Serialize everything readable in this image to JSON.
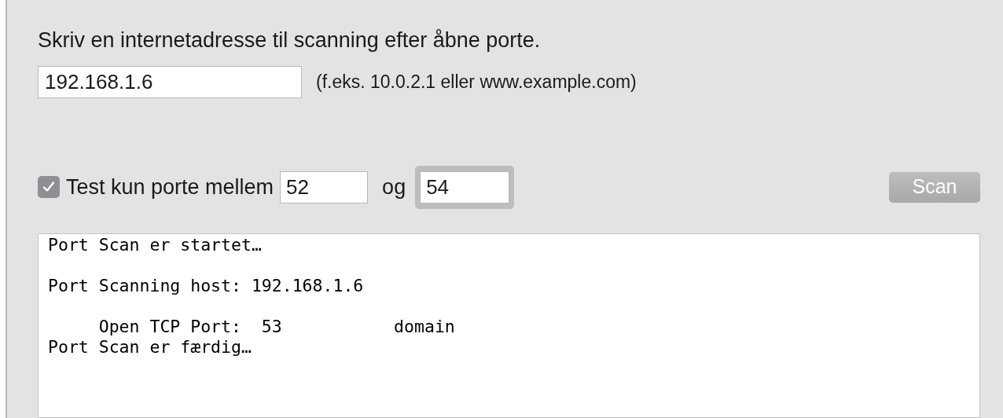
{
  "instruction": "Skriv en internetadresse til scanning efter åbne porte.",
  "address": {
    "value": "192.168.1.6",
    "hint": "(f.eks. 10.0.2.1 eller www.example.com)"
  },
  "range": {
    "checked": true,
    "label": "Test kun porte mellem",
    "from": "52",
    "joiner": "og",
    "to": "54",
    "to_focused": true
  },
  "scan_button": {
    "label": "Scan",
    "disabled": true
  },
  "output_paragraphs": [
    [
      "Port Scan er startet…"
    ],
    [
      "Port Scanning host: 192.168.1.6"
    ],
    [
      "     Open TCP Port:  53           domain",
      "Port Scan er færdig…"
    ]
  ]
}
